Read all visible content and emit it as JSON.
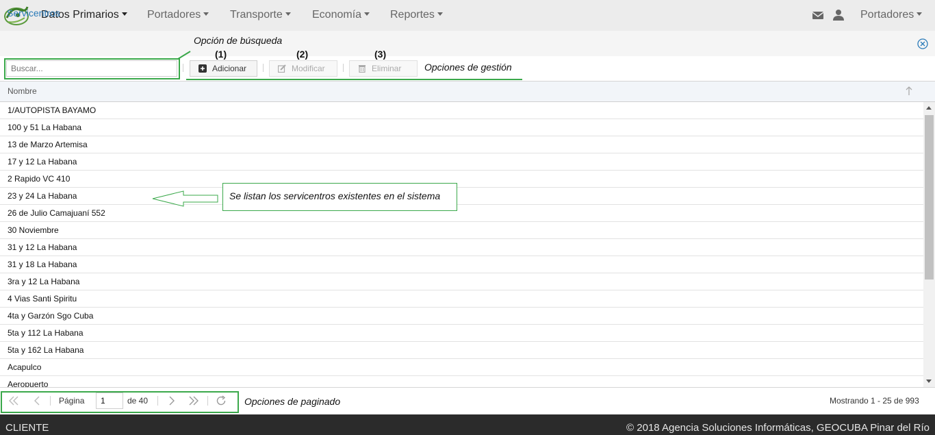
{
  "nav": {
    "items": [
      {
        "label": "Datos Primarios",
        "active": true
      },
      {
        "label": "Portadores",
        "active": false
      },
      {
        "label": "Transporte",
        "active": false
      },
      {
        "label": "Economía",
        "active": false
      },
      {
        "label": "Reportes",
        "active": false
      }
    ],
    "mail_icon": "envelope-icon",
    "user_icon": "user-icon",
    "user_menu": "Portadores"
  },
  "panel": {
    "title": "Servicentros",
    "close_icon": "close-circle-icon"
  },
  "toolbar": {
    "search_placeholder": "Buscar...",
    "add_label": "Adicionar",
    "edit_label": "Modificar",
    "delete_label": "Eliminar"
  },
  "annotations": {
    "search": "Opción de búsqueda",
    "num1": "(1)",
    "num2": "(2)",
    "num3": "(3)",
    "management": "Opciones de gestión",
    "list": "Se listan los servicentros existentes en el sistema",
    "paging": "Opciones de paginado",
    "accent": "#3aa84a"
  },
  "grid": {
    "column": "Nombre",
    "rows": [
      "1/AUTOPISTA BAYAMO",
      "100 y 51 La Habana",
      "13 de Marzo Artemisa",
      "17 y 12 La Habana",
      "2 Rapido VC 410",
      "23 y 24 La Habana",
      "26 de Julio Camajuaní 552",
      "30 Noviembre",
      "31 y 12 La Habana",
      "31 y 18 La Habana",
      "3ra y 12 La Habana",
      "4 Vias Santi Spiritu",
      "4ta y Garzón Sgo Cuba",
      "5ta y 112 La Habana",
      "5ta y 162 La Habana",
      "Acapulco",
      "Aeropuerto"
    ]
  },
  "pager": {
    "page_label": "Página",
    "page_value": "1",
    "of_label": "de 40",
    "showing": "Mostrando 1 - 25 de 993"
  },
  "footer": {
    "left": "CLIENTE",
    "right": "© 2018 Agencia Soluciones Informáticas, GEOCUBA Pinar del Río"
  }
}
